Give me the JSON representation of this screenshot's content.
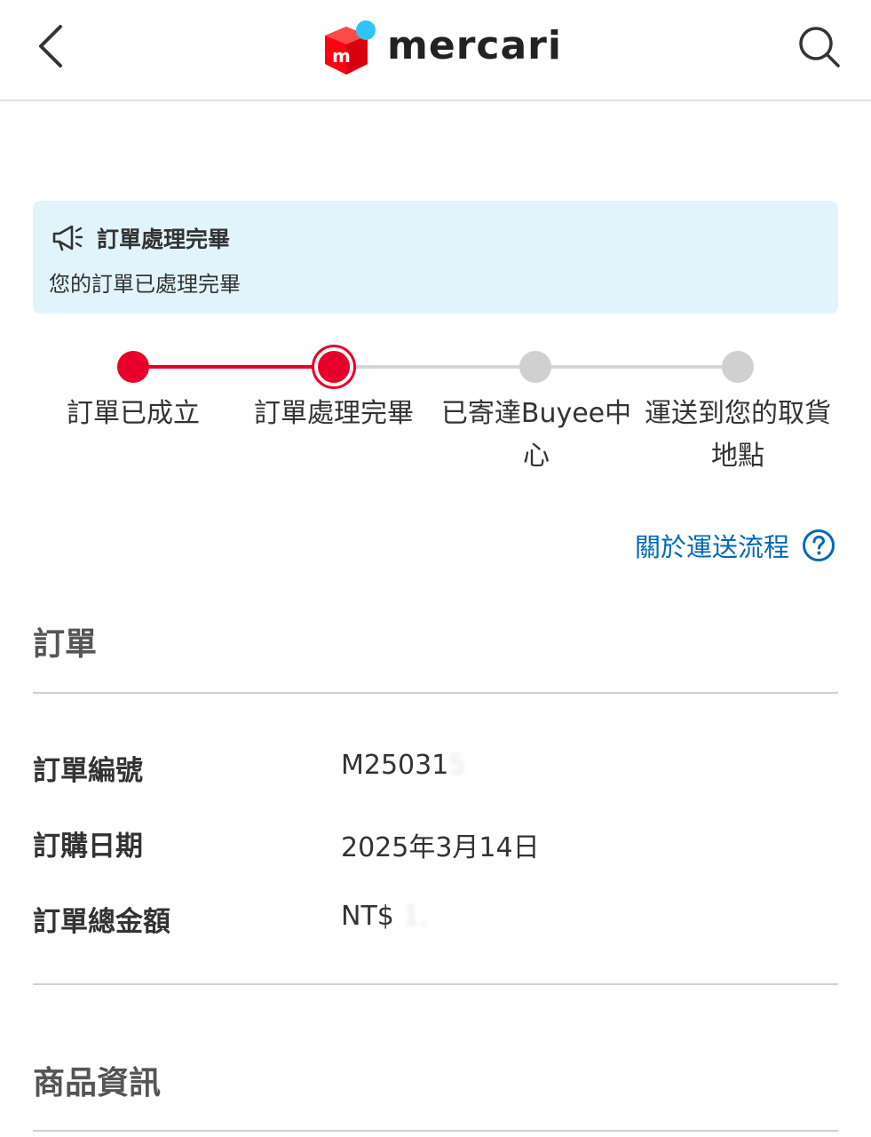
{
  "header": {
    "logo_text": "mercari",
    "logo_badge": "m",
    "brand_colors": {
      "red": "#ff0211",
      "blue": "#2ec4f3"
    }
  },
  "notice": {
    "title": "訂單處理完畢",
    "body": "您的訂單已處理完畢"
  },
  "steps": [
    {
      "label": "訂單已成立",
      "state": "done"
    },
    {
      "label": "訂單處理完畢",
      "state": "current"
    },
    {
      "label": "已寄達Buyee中心",
      "state": "pending"
    },
    {
      "label": "運送到您的取貨地點",
      "state": "pending"
    }
  ],
  "accent_color": "#e8002b",
  "help": {
    "text": "關於運送流程",
    "icon": "question-circle-icon"
  },
  "order": {
    "section_title": "訂單",
    "rows": [
      {
        "label": "訂單編號",
        "value": "M25031",
        "value_obscured": "5"
      },
      {
        "label": "訂購日期",
        "value": "2025年3月14日",
        "value_obscured": ""
      },
      {
        "label": "訂單總金額",
        "value": "NT$",
        "value_obscured": "1,"
      }
    ]
  },
  "product": {
    "section_title": "商品資訊"
  }
}
